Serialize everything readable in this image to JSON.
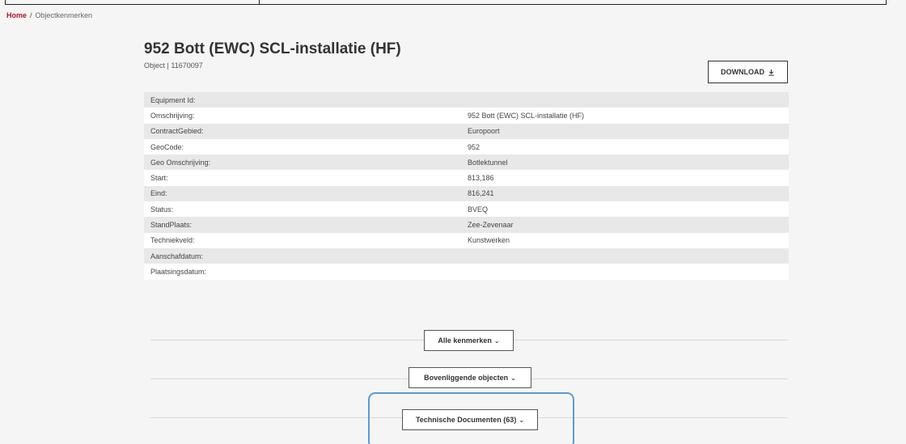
{
  "breadcrumb": {
    "home": "Home",
    "separator": "/",
    "current": "Objectkenmerken"
  },
  "header": {
    "title": "952 Bott (EWC) SCL-installatie (HF)",
    "subtitle": "Object | 11670097"
  },
  "download": {
    "label": "DOWNLOAD",
    "icon": "download-icon"
  },
  "properties": [
    {
      "label": "Equipment Id:",
      "value": ""
    },
    {
      "label": "Omschrijving:",
      "value": "952 Bott (EWC) SCL-installatie (HF)"
    },
    {
      "label": "ContractGebied:",
      "value": "Europoort"
    },
    {
      "label": "GeoCode:",
      "value": "952"
    },
    {
      "label": "Geo Omschrijving:",
      "value": "Botlektunnel"
    },
    {
      "label": "Start:",
      "value": "813,186"
    },
    {
      "label": "Eind:",
      "value": "816,241"
    },
    {
      "label": "Status:",
      "value": "BVEQ"
    },
    {
      "label": "StandPlaats:",
      "value": "Zee-Zevenaar"
    },
    {
      "label": "Techniekveld:",
      "value": "Kunstwerken"
    },
    {
      "label": "Aanschafdatum:",
      "value": ""
    },
    {
      "label": "Plaatsingsdatum:",
      "value": ""
    }
  ],
  "sections": [
    {
      "label": "Alle kenmerken",
      "icon": "chevron-down-icon"
    },
    {
      "label": "Bovenliggende objecten",
      "icon": "chevron-down-icon"
    },
    {
      "label": "Technische Documenten (63)",
      "icon": "chevron-down-icon"
    }
  ],
  "colors": {
    "brand": "#b0122c",
    "highlight": "#5b9bd5",
    "row_alt": "#e8e8e8"
  }
}
